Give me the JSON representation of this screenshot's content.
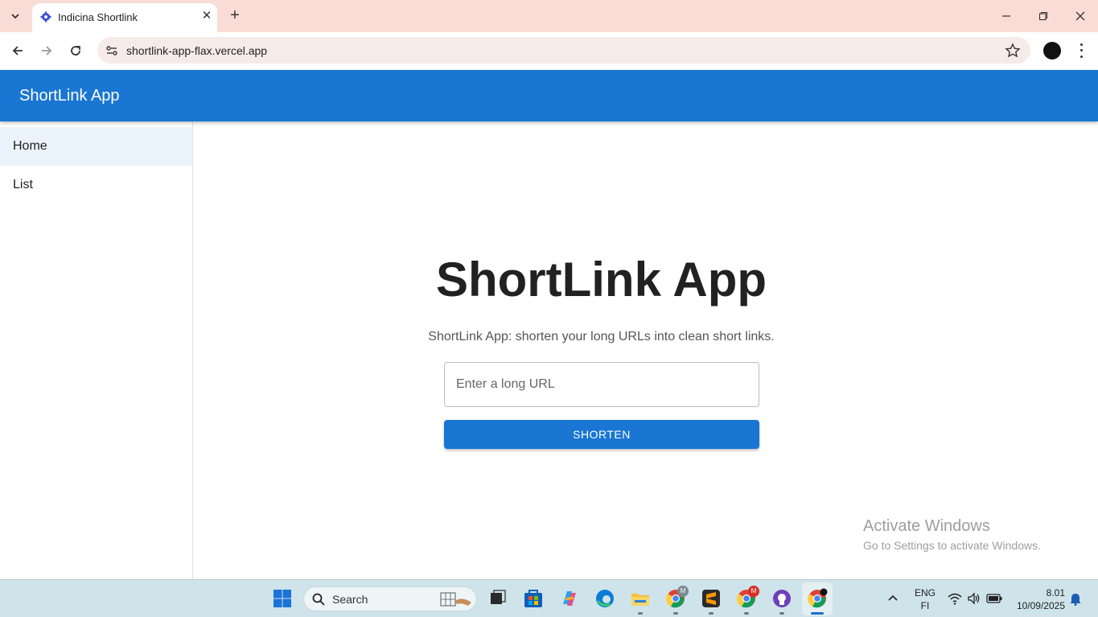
{
  "browser": {
    "tab_title": "Indicina Shortlink",
    "url": "shortlink-app-flax.vercel.app"
  },
  "app": {
    "title": "ShortLink App"
  },
  "sidebar": {
    "items": [
      {
        "label": "Home",
        "active": true
      },
      {
        "label": "List",
        "active": false
      }
    ]
  },
  "main": {
    "heading": "ShortLink App",
    "subtitle": "ShortLink App: shorten your long URLs into clean short links.",
    "input_placeholder": "Enter a long URL",
    "input_value": "",
    "button_label": "SHORTEN"
  },
  "watermark": {
    "line1": "Activate Windows",
    "line2": "Go to Settings to activate Windows."
  },
  "taskbar": {
    "search_label": "Search",
    "language": "ENG",
    "region": "FI",
    "time": "8.01",
    "date": "10/09/2025",
    "badges": {
      "chrome_m": "M",
      "chrome_red_m": "M"
    }
  },
  "colors": {
    "primary": "#1976d2",
    "tabstrip": "#fadcd6",
    "taskbar": "#cfe3ea"
  }
}
